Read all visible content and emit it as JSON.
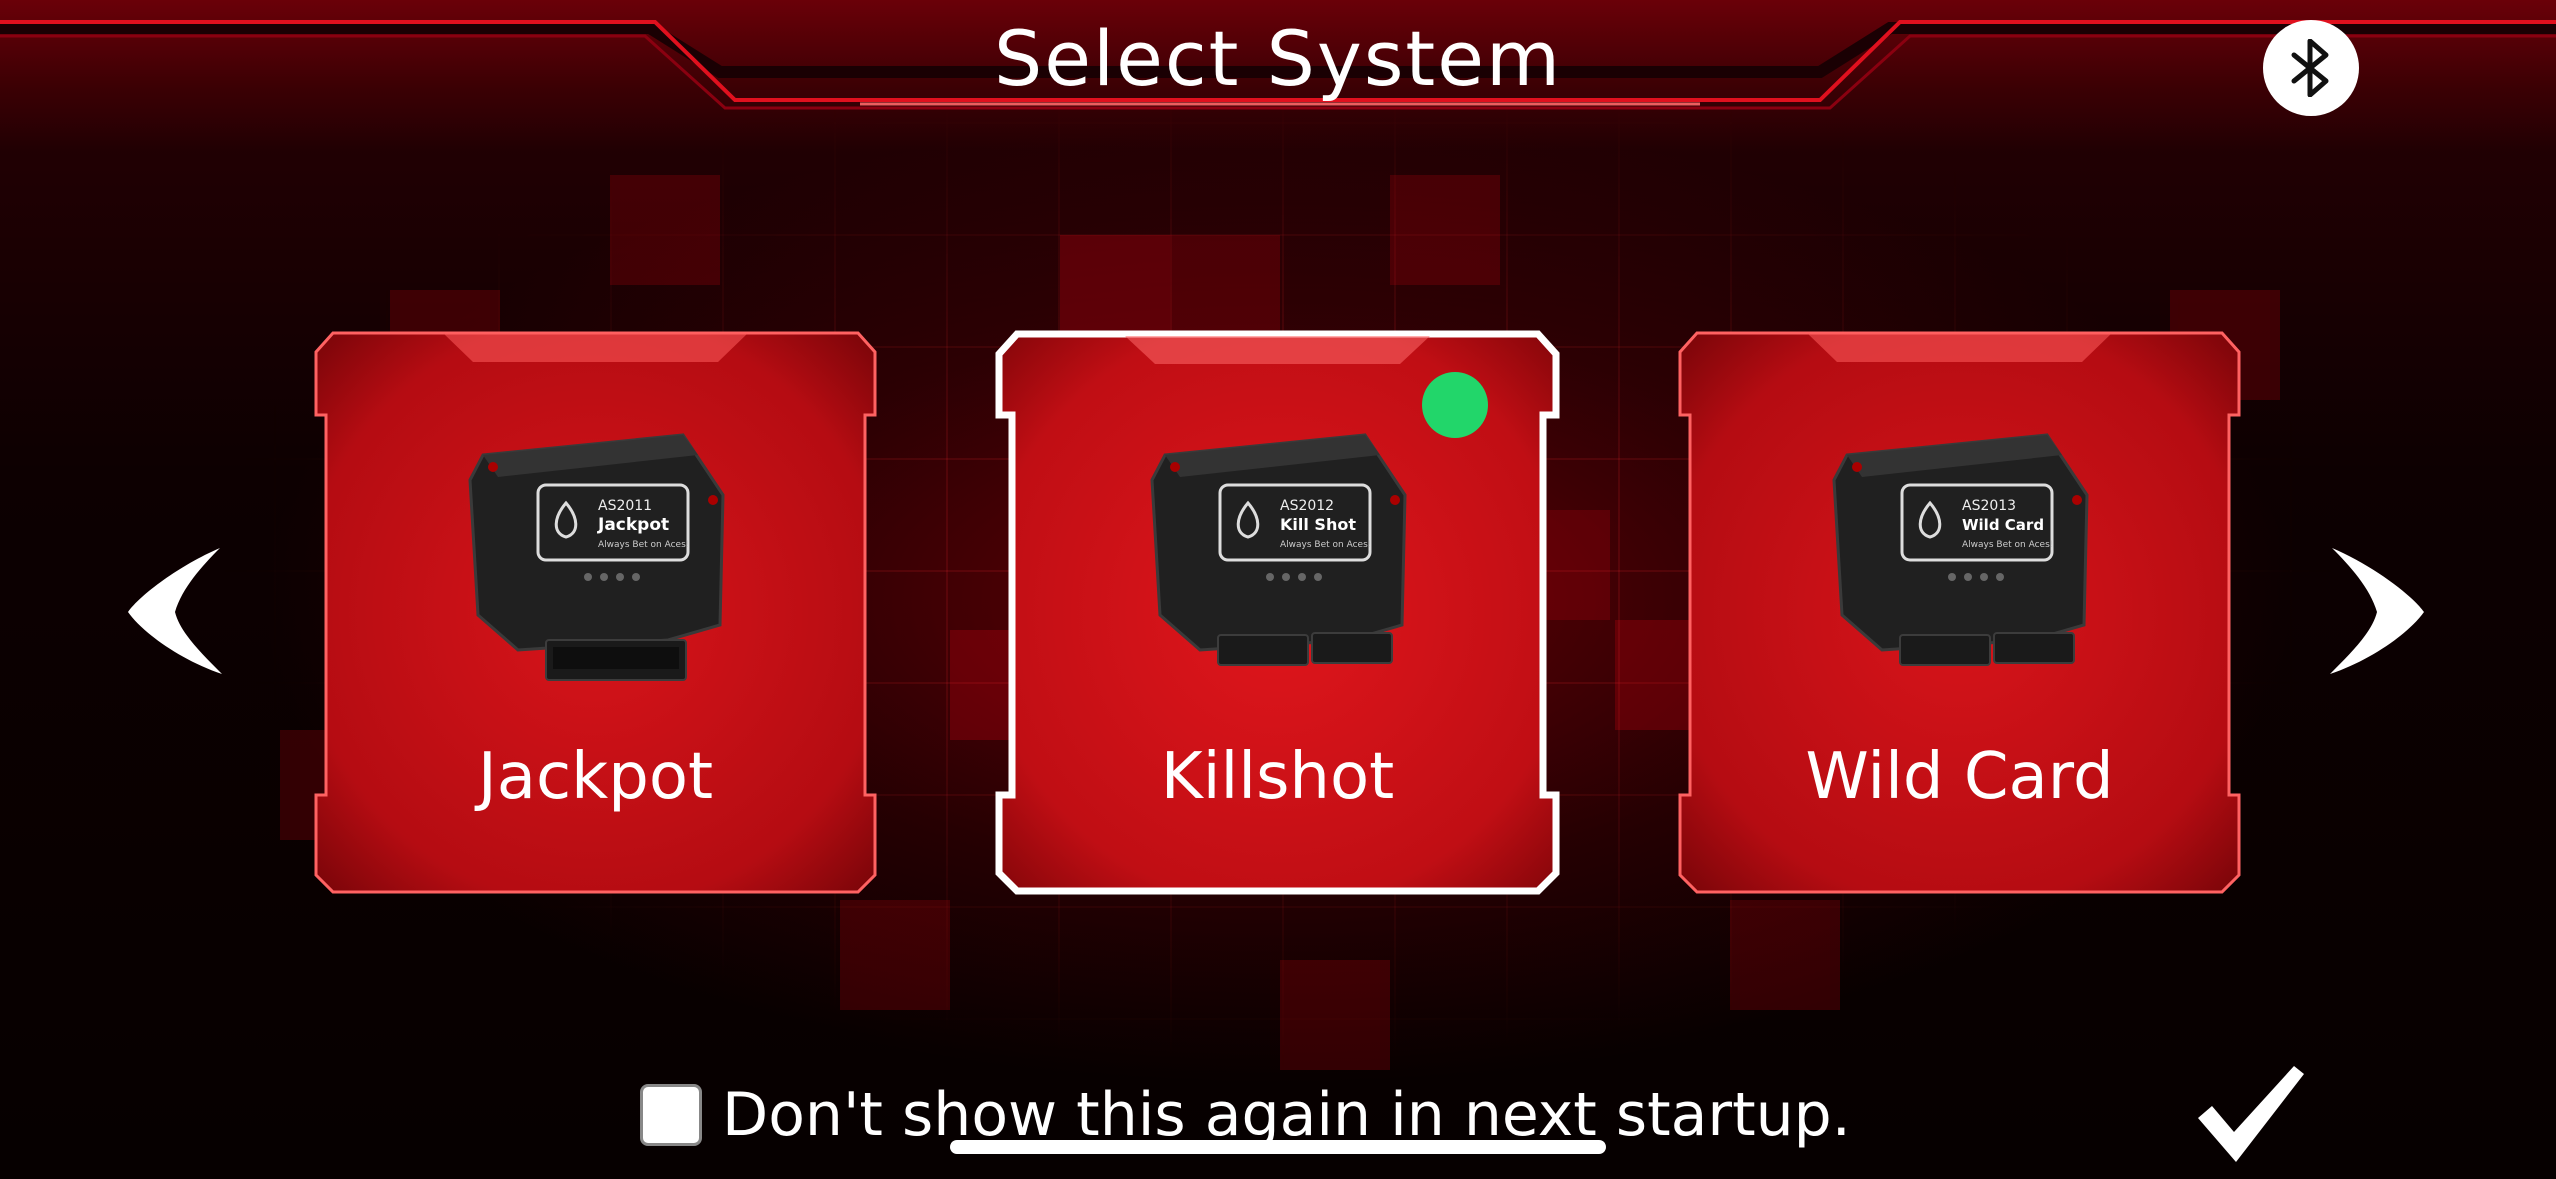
{
  "header": {
    "title": "Select System",
    "bluetooth_icon": "bluetooth-icon"
  },
  "systems": [
    {
      "label": "Jackpot",
      "selected": false,
      "device_model": "AS2011",
      "device_name": "Jackpot"
    },
    {
      "label": "Killshot",
      "selected": true,
      "connected": true,
      "device_model": "AS2012",
      "device_name": "Kill Shot"
    },
    {
      "label": "Wild Card",
      "selected": false,
      "device_model": "AS2013",
      "device_name": "Wild Card"
    }
  ],
  "device_tagline": "Always Bet on Aces!",
  "navigation": {
    "prev_icon": "chevron-left-icon",
    "next_icon": "chevron-right-icon"
  },
  "footer": {
    "checkbox_checked": false,
    "dont_show_label": "Don't show this again in next startup.",
    "confirm_icon": "checkmark-icon"
  },
  "colors": {
    "card_red": "#c80d12",
    "card_border": "#ff5a5a",
    "selected_border": "#ffffff",
    "status_green": "#22d66a",
    "background": "#0a0001"
  }
}
